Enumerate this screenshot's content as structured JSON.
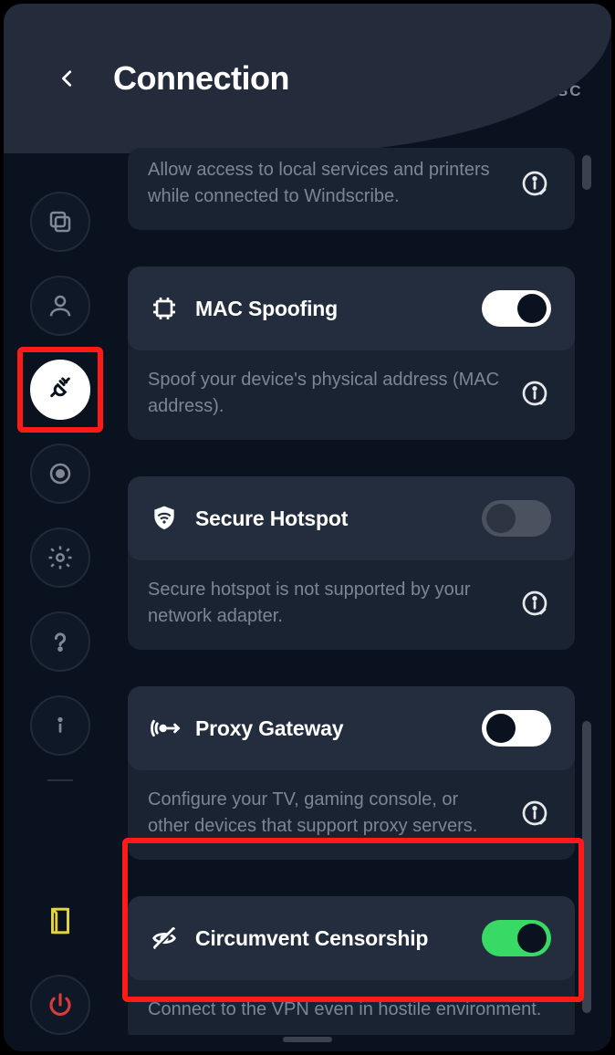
{
  "header": {
    "title": "Connection",
    "esc_label": "ESC"
  },
  "sidebar": {
    "items": [
      {
        "name": "general-icon"
      },
      {
        "name": "account-icon"
      },
      {
        "name": "connection-icon"
      },
      {
        "name": "rules-icon"
      },
      {
        "name": "settings-icon"
      },
      {
        "name": "help-icon"
      },
      {
        "name": "about-icon"
      }
    ],
    "bottom": [
      {
        "name": "log-icon"
      },
      {
        "name": "power-icon"
      }
    ]
  },
  "settings": {
    "lan_traffic": {
      "desc": "Allow access to local services and printers while connected to Windscribe."
    },
    "mac_spoofing": {
      "title": "MAC Spoofing",
      "desc": "Spoof your device's physical address (MAC address).",
      "state": "on"
    },
    "secure_hotspot": {
      "title": "Secure Hotspot",
      "desc": "Secure hotspot is not supported by your network adapter.",
      "state": "disabled"
    },
    "proxy_gateway": {
      "title": "Proxy Gateway",
      "desc": "Configure your TV, gaming console, or other devices that support proxy servers.",
      "state": "off"
    },
    "circumvent": {
      "title": "Circumvent Censorship",
      "desc": "Connect to the VPN even in hostile environment.",
      "state": "on-green"
    }
  }
}
